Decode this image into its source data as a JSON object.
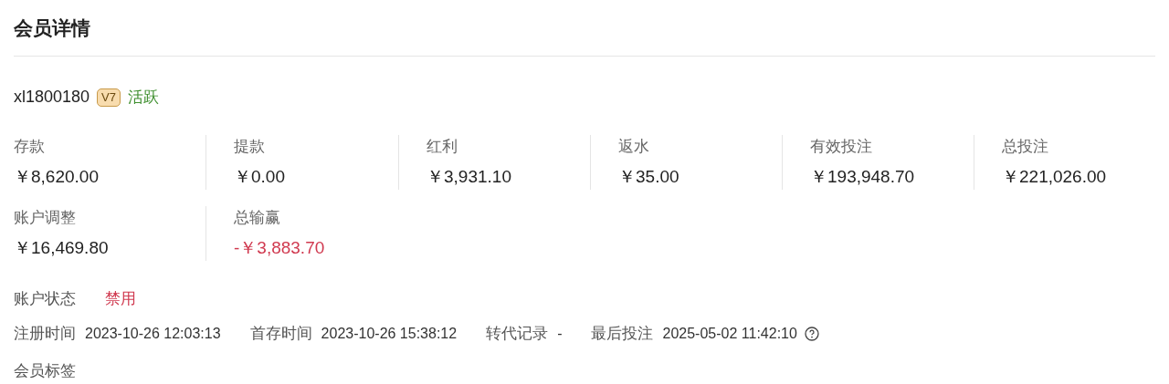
{
  "title": "会员详情",
  "member": {
    "username": "xl1800180",
    "vip_badge": "V7",
    "activity": {
      "label": "活跃",
      "color": "#3f8f2f"
    }
  },
  "stats_rows": [
    [
      {
        "label": "存款",
        "value": "￥8,620.00",
        "color": "#222222"
      },
      {
        "label": "提款",
        "value": "￥0.00",
        "color": "#222222"
      },
      {
        "label": "红利",
        "value": "￥3,931.10",
        "color": "#222222"
      },
      {
        "label": "返水",
        "value": "￥35.00",
        "color": "#222222"
      },
      {
        "label": "有效投注",
        "value": "￥193,948.70",
        "color": "#222222"
      },
      {
        "label": "总投注",
        "value": "￥221,026.00",
        "color": "#222222"
      }
    ],
    [
      {
        "label": "账户调整",
        "value": "￥16,469.80",
        "color": "#222222"
      },
      {
        "label": "总输赢",
        "value": "-￥3,883.70",
        "color": "#d0394f"
      }
    ]
  ],
  "account_status": {
    "label": "账户状态",
    "value": "禁用",
    "color": "#d0394f"
  },
  "info_fields": [
    {
      "label": "注册时间",
      "value": "2023-10-26 12:03:13",
      "help": false
    },
    {
      "label": "首存时间",
      "value": "2023-10-26 15:38:12",
      "help": false
    },
    {
      "label": "转代记录",
      "value": "-",
      "help": false
    },
    {
      "label": "最后投注",
      "value": "2025-05-02 11:42:10",
      "help": true
    }
  ],
  "tags_label": "会员标签"
}
